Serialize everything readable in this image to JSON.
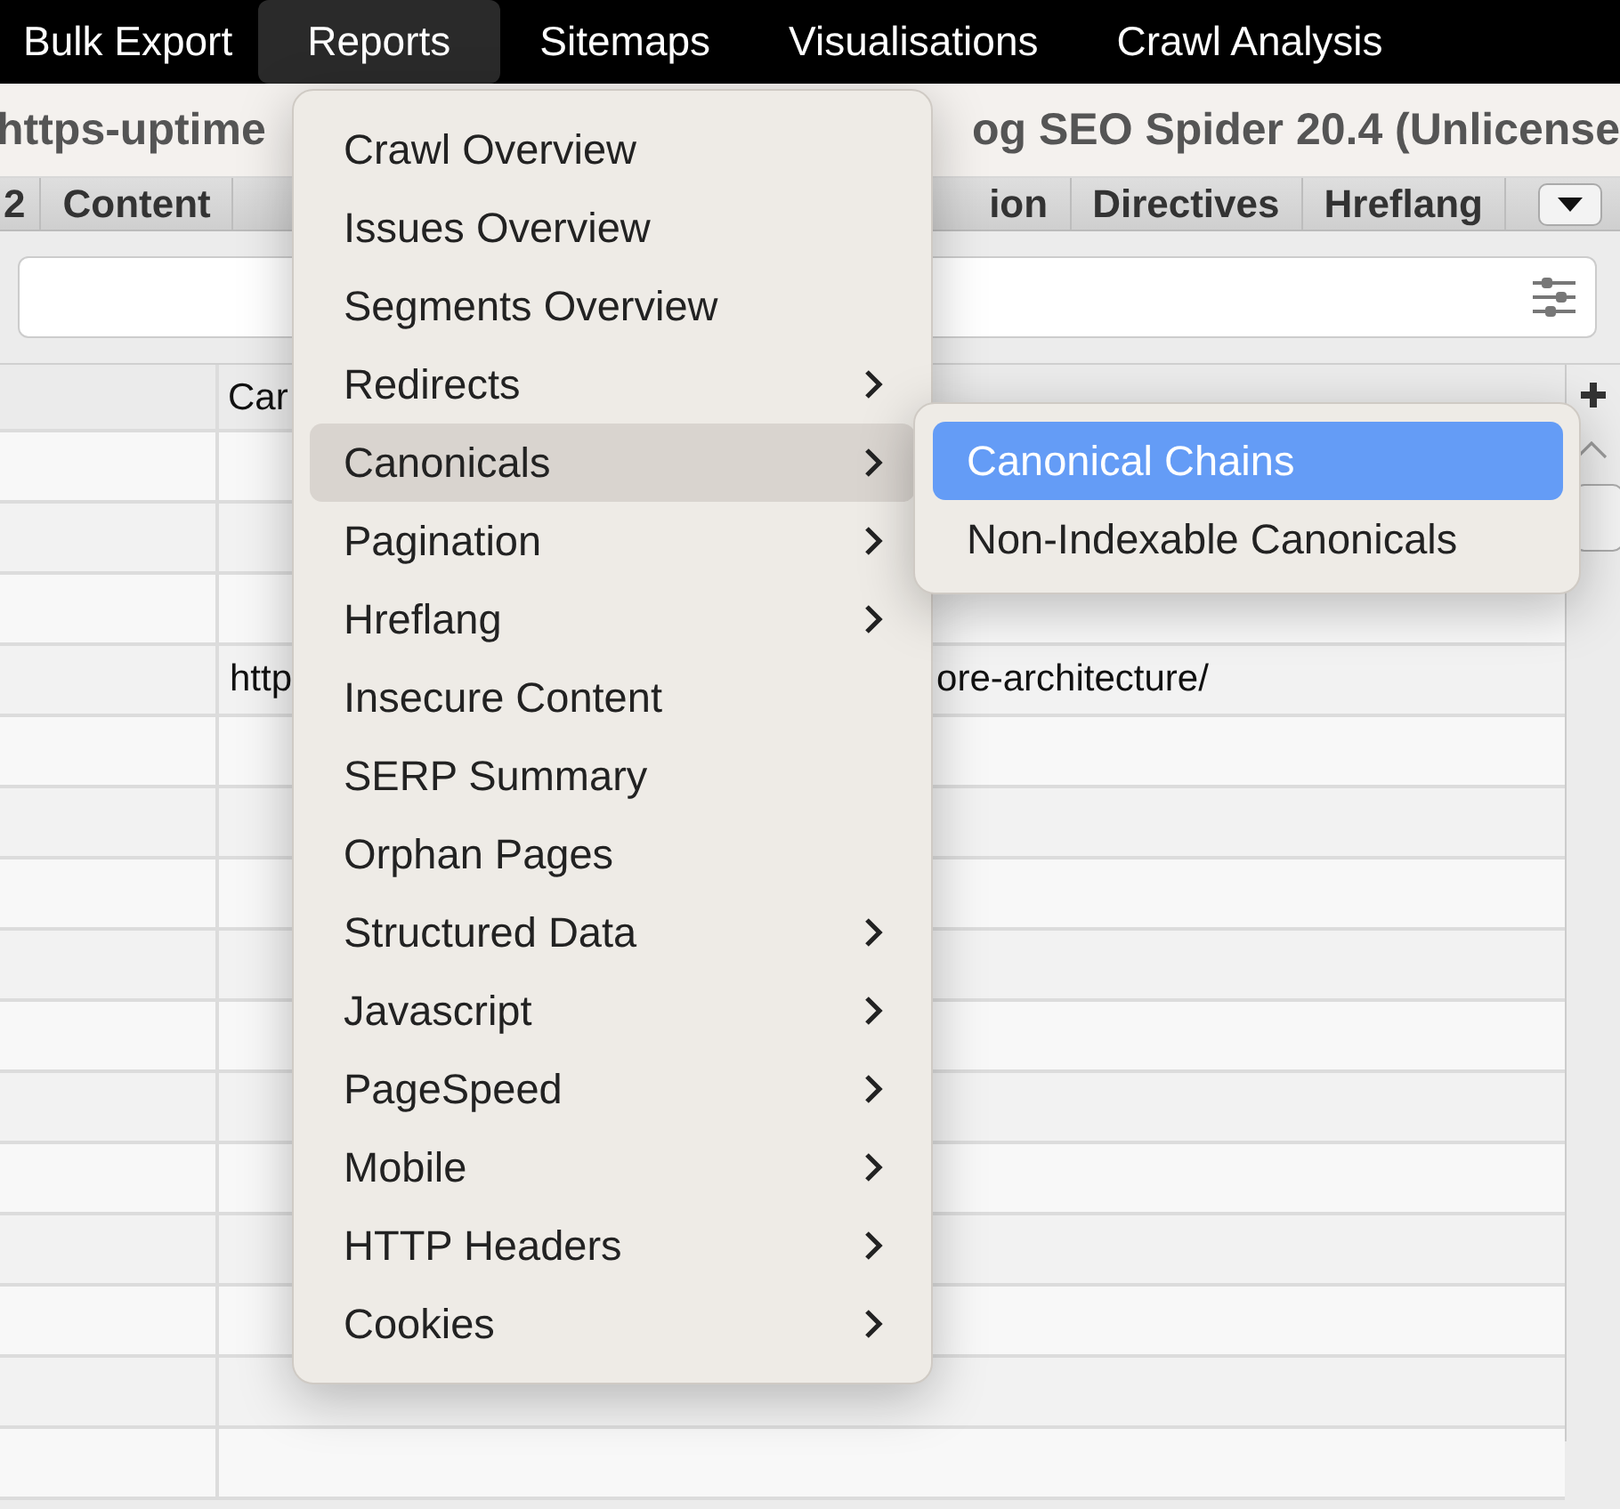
{
  "menu_bar": {
    "items": [
      {
        "label": "Bulk Export",
        "selected": false
      },
      {
        "label": "Reports",
        "selected": true
      },
      {
        "label": "Sitemaps",
        "selected": false
      },
      {
        "label": "Visualisations",
        "selected": false
      },
      {
        "label": "Crawl Analysis",
        "selected": false
      }
    ]
  },
  "title_bar": {
    "left_text": "https-uptime",
    "right_text": "og SEO Spider 20.4 (Unlicense"
  },
  "tabs": {
    "left": [
      {
        "label": "2"
      },
      {
        "label": "Content"
      }
    ],
    "right": [
      {
        "label": "ion"
      },
      {
        "label": "Directives"
      },
      {
        "label": "Hreflang"
      }
    ]
  },
  "table": {
    "column_2_header": "Car",
    "rows": [
      {
        "column_2": [
          "http",
          "ore-architecture/"
        ]
      }
    ]
  },
  "reports_menu": {
    "items": [
      {
        "label": "Crawl Overview",
        "submenu": false,
        "selected": false
      },
      {
        "label": "Issues Overview",
        "submenu": false,
        "selected": false
      },
      {
        "label": "Segments Overview",
        "submenu": false,
        "selected": false
      },
      {
        "label": "Redirects",
        "submenu": true,
        "selected": false
      },
      {
        "label": "Canonicals",
        "submenu": true,
        "selected": true
      },
      {
        "label": "Pagination",
        "submenu": true,
        "selected": false
      },
      {
        "label": "Hreflang",
        "submenu": true,
        "selected": false
      },
      {
        "label": "Insecure Content",
        "submenu": false,
        "selected": false
      },
      {
        "label": "SERP Summary",
        "submenu": false,
        "selected": false
      },
      {
        "label": "Orphan Pages",
        "submenu": false,
        "selected": false
      },
      {
        "label": "Structured Data",
        "submenu": true,
        "selected": false
      },
      {
        "label": "Javascript",
        "submenu": true,
        "selected": false
      },
      {
        "label": "PageSpeed",
        "submenu": true,
        "selected": false
      },
      {
        "label": "Mobile",
        "submenu": true,
        "selected": false
      },
      {
        "label": "HTTP Headers",
        "submenu": true,
        "selected": false
      },
      {
        "label": "Cookies",
        "submenu": true,
        "selected": false
      }
    ]
  },
  "canonicals_submenu": {
    "items": [
      {
        "label": "Canonical Chains",
        "selected": true
      },
      {
        "label": "Non-Indexable Canonicals",
        "selected": false
      }
    ]
  }
}
